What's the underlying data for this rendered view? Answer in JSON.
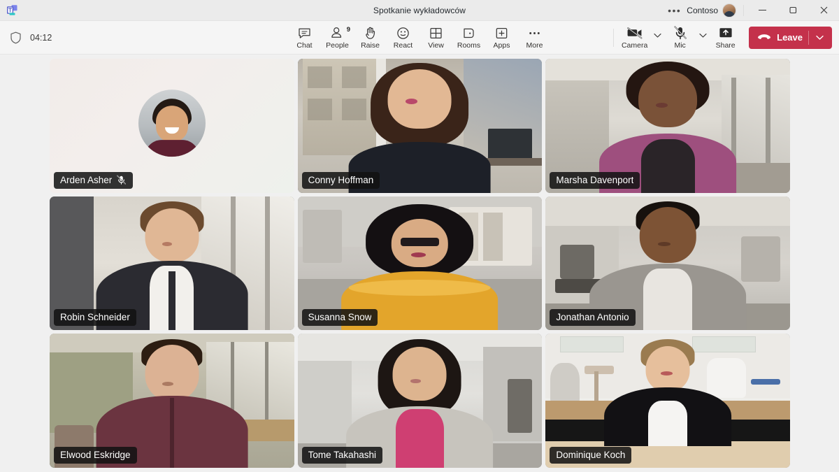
{
  "titlebar": {
    "app_icon": "teams-logo-icon",
    "title": "Spotkanie wykładowców",
    "overflow_label": "•••",
    "org_name": "Contoso",
    "minimize_label": "Minimize",
    "maximize_label": "Maximize",
    "close_label": "Close"
  },
  "actionbar": {
    "shield_icon": "shield-icon",
    "timer": "04:12",
    "tools": [
      {
        "icon": "chat-icon",
        "label": "Chat",
        "badge": ""
      },
      {
        "icon": "people-icon",
        "label": "People",
        "badge": "9"
      },
      {
        "icon": "raise-hand-icon",
        "label": "Raise",
        "badge": ""
      },
      {
        "icon": "react-emoji-icon",
        "label": "React",
        "badge": ""
      },
      {
        "icon": "view-grid-icon",
        "label": "View",
        "badge": ""
      },
      {
        "icon": "rooms-icon",
        "label": "Rooms",
        "badge": ""
      },
      {
        "icon": "apps-plus-icon",
        "label": "Apps",
        "badge": ""
      },
      {
        "icon": "more-ellipsis-icon",
        "label": "More",
        "badge": ""
      }
    ],
    "camera": {
      "icon": "camera-off-icon",
      "label": "Camera",
      "state": "off"
    },
    "mic": {
      "icon": "mic-off-icon",
      "label": "Mic",
      "state": "off"
    },
    "share": {
      "icon": "share-screen-icon",
      "label": "Share"
    },
    "leave": {
      "label": "Leave",
      "icon": "hang-up-icon",
      "color": "#c4314b"
    }
  },
  "stage": {
    "layout": "gallery-3x3",
    "participants": [
      {
        "name": "Arden Asher",
        "video": false,
        "muted": true,
        "tile_class": "avatar-tile"
      },
      {
        "name": "Conny Hoffman",
        "video": true,
        "muted": false,
        "tile_class": "t2bg"
      },
      {
        "name": "Marsha Davenport",
        "video": true,
        "muted": false,
        "tile_class": "t3bg"
      },
      {
        "name": "Robin Schneider",
        "video": true,
        "muted": false,
        "tile_class": "t4bg"
      },
      {
        "name": "Susanna Snow",
        "video": true,
        "muted": false,
        "tile_class": "t5bg"
      },
      {
        "name": "Jonathan Antonio",
        "video": true,
        "muted": false,
        "tile_class": "t6bg"
      },
      {
        "name": "Elwood Eskridge",
        "video": true,
        "muted": false,
        "tile_class": "t7bg"
      },
      {
        "name": "Tome Takahashi",
        "video": true,
        "muted": false,
        "tile_class": "t8bg"
      },
      {
        "name": "Dominique Koch",
        "video": true,
        "muted": false,
        "tile_class": "t9bg"
      }
    ]
  },
  "colors": {
    "window_bg": "#f0f0f0",
    "titlebar_bg": "#ebebeb",
    "actionbar_bg": "#f5f5f5",
    "leave_red": "#c4314b",
    "name_chip_bg": "rgba(17,17,17,.86)",
    "text_primary": "#252423"
  }
}
